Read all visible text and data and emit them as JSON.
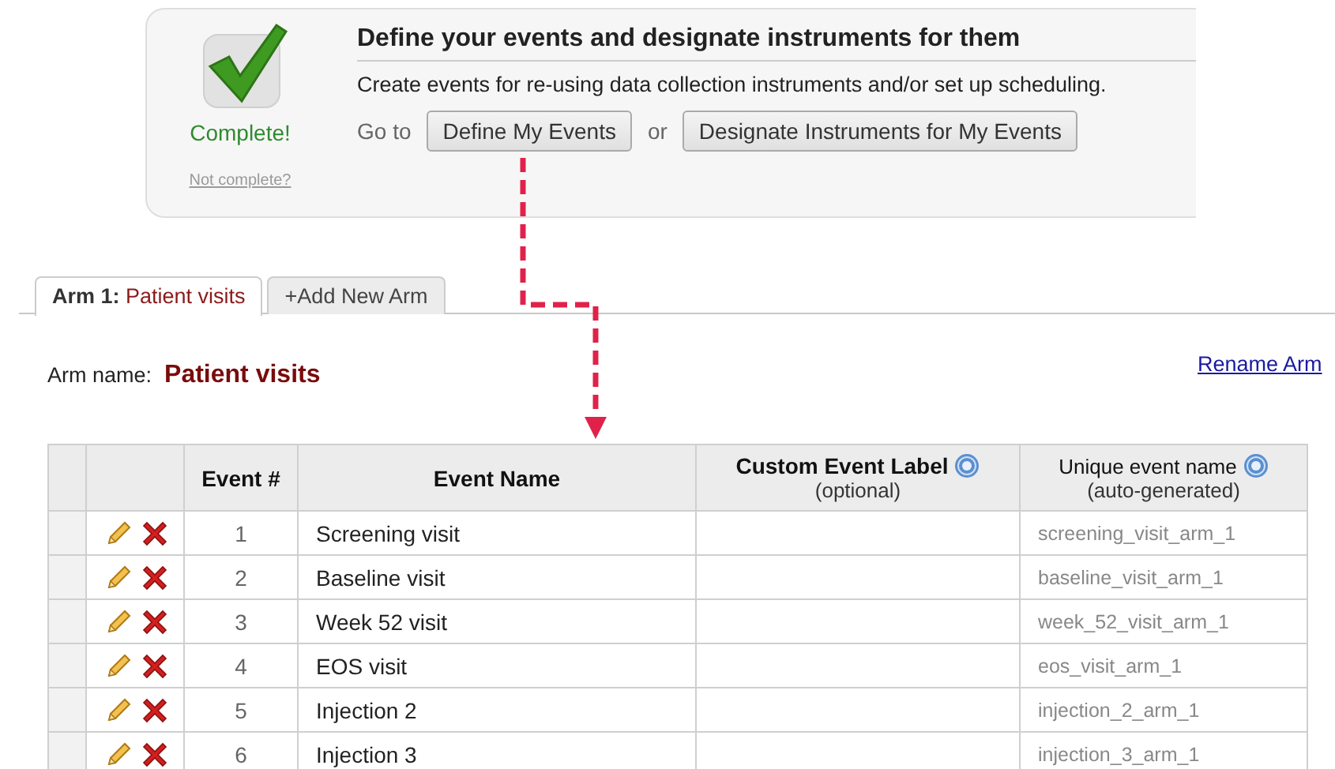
{
  "setup_step": {
    "status": "Complete!",
    "not_complete_link": "Not complete?",
    "title": "Define your events and designate instruments for them",
    "description": "Create events for re-using data collection instruments and/or set up scheduling.",
    "goto_label": "Go to",
    "or_label": "or",
    "buttons": [
      "Define My Events",
      "Designate Instruments for My Events"
    ]
  },
  "tabs": [
    {
      "prefix": "Arm 1:",
      "label": "Patient visits",
      "selected": true
    },
    {
      "label": "+Add New Arm",
      "selected": false
    }
  ],
  "arm_name": {
    "label": "Arm name:",
    "value": "Patient visits"
  },
  "rename_link": "Rename Arm",
  "table": {
    "columns": [
      {
        "title": "Event #",
        "bold": true
      },
      {
        "title": "Event Name",
        "bold": true
      },
      {
        "title": "Custom Event Label",
        "subtitle": "(optional)",
        "bold": true,
        "help": true
      },
      {
        "title": "Unique event name",
        "subtitle": "(auto-generated)",
        "bold": false,
        "help": true
      }
    ],
    "rows": [
      {
        "number": "1",
        "name": "Screening visit",
        "unique_name": "screening_visit_arm_1"
      },
      {
        "number": "2",
        "name": "Baseline visit",
        "unique_name": "baseline_visit_arm_1"
      },
      {
        "number": "3",
        "name": "Week 52 visit",
        "unique_name": "week_52_visit_arm_1"
      },
      {
        "number": "4",
        "name": "EOS visit",
        "unique_name": "eos_visit_arm_1"
      },
      {
        "number": "5",
        "name": "Injection 2",
        "unique_name": "injection_2_arm_1"
      },
      {
        "number": "6",
        "name": "Injection 3",
        "unique_name": "injection_3_arm_1"
      }
    ]
  }
}
